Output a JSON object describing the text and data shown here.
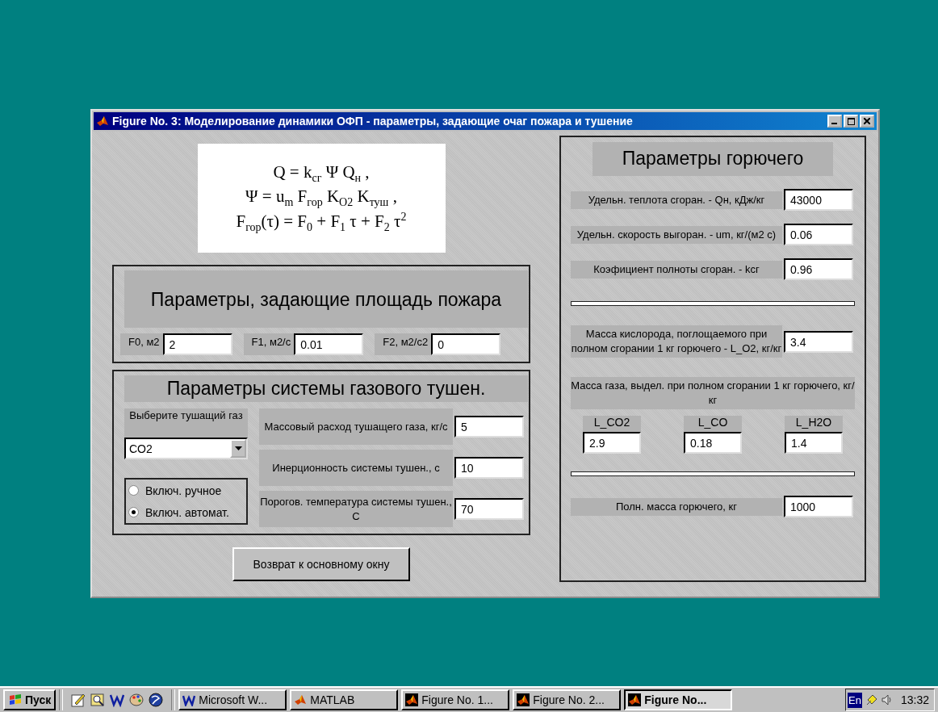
{
  "window": {
    "title": "Figure No. 3: Моделирование динамики ОФП - параметры, задающие очаг пожара и тушение"
  },
  "formulas": [
    "Q = k$_{сг}$ Ψ Q$_{н}$ ,",
    "Ψ = u$_{m}$ F$_{гор}$ K$_{O2}$ K$_{туш}$ ,",
    "F$_{гор}$(τ) = F$_{0}$ + F$_{1}$ τ + F$_{2}$ τ$^{2}$"
  ],
  "area_panel": {
    "title": "Параметры, задающие площадь пожара",
    "fields": [
      {
        "label": "F0, м2",
        "value": "2"
      },
      {
        "label": "F1, м2/с",
        "value": "0.01"
      },
      {
        "label": "F2, м2/с2",
        "value": "0"
      }
    ]
  },
  "extinguishing_panel": {
    "title": "Параметры системы газового тушен.",
    "gas_label": "Выберите тушащий газ",
    "gas_select": {
      "value": "CO2"
    },
    "modes": [
      {
        "label": "Включ. ручное",
        "selected": false
      },
      {
        "label": "Включ. автомат.",
        "selected": true
      }
    ],
    "fields": [
      {
        "label": "Массовый расход тушащего газа, кг/с",
        "value": "5"
      },
      {
        "label": "Инерционность системы тушен., с",
        "value": "10"
      },
      {
        "label": "Порогов. температура системы тушен., С",
        "value": "70"
      }
    ]
  },
  "back_button": "Возврат к основному окну",
  "fuel_panel": {
    "title": "Параметры горючего",
    "fields": [
      {
        "label": "Удельн. теплота сгоран. - Qн, кДж/кг",
        "value": "43000"
      },
      {
        "label": "Удельн. скорость выгоран. - um, кг/(м2 с)",
        "value": "0.06"
      },
      {
        "label": "Коэфициент полноты сгоран. - kсг",
        "value": "0.96"
      }
    ],
    "oxygen": {
      "label": "Масса кислорода, поглощаемого при полном сгорании 1 кг горючего - L_O2, кг/кг",
      "value": "3.4"
    },
    "gas_release": {
      "label": "Масса газа, выдел. при полном сгорании 1 кг горючего, кг/кг",
      "fields": [
        {
          "label": "L_CO2",
          "value": "2.9"
        },
        {
          "label": "L_CO",
          "value": "0.18"
        },
        {
          "label": "L_H2O",
          "value": "1.4"
        }
      ]
    },
    "total_mass": {
      "label": "Полн. масса горючего, кг",
      "value": "1000"
    }
  },
  "taskbar": {
    "start": "Пуск",
    "tasks": [
      {
        "label": "Microsoft W...",
        "kind": "word",
        "selected": false
      },
      {
        "label": "MATLAB",
        "kind": "matlab",
        "selected": false
      },
      {
        "label": "Figure No. 1...",
        "kind": "figure",
        "selected": false
      },
      {
        "label": "Figure No. 2...",
        "kind": "figure",
        "selected": false
      },
      {
        "label": "Figure No...",
        "kind": "figure",
        "selected": true
      }
    ],
    "language": "En",
    "time": "13:32"
  }
}
